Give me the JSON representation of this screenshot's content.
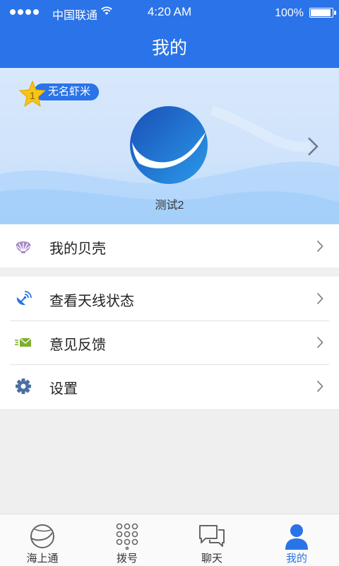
{
  "status_bar": {
    "carrier": "中国联通",
    "time": "4:20 AM",
    "battery": "100%",
    "battery_level": 1.0
  },
  "header": {
    "title": "我的"
  },
  "profile": {
    "rank_number": "1",
    "rank_title": "无名虾米",
    "username": "测试2"
  },
  "menu": {
    "shells": {
      "label": "我的贝壳",
      "icon": "shell-icon"
    },
    "antenna": {
      "label": "查看天线状态",
      "icon": "antenna-icon"
    },
    "feedback": {
      "label": "意见反馈",
      "icon": "mail-icon"
    },
    "settings": {
      "label": "设置",
      "icon": "gear-icon"
    }
  },
  "tabbar": {
    "tabs": [
      {
        "label": "海上通",
        "icon": "globe-icon",
        "active": false
      },
      {
        "label": "拨号",
        "icon": "dialpad-icon",
        "active": false
      },
      {
        "label": "聊天",
        "icon": "chat-icon",
        "active": false
      },
      {
        "label": "我的",
        "icon": "person-icon",
        "active": true
      }
    ]
  },
  "colors": {
    "brand_blue": "#2a73e8",
    "background": "#efefef"
  }
}
